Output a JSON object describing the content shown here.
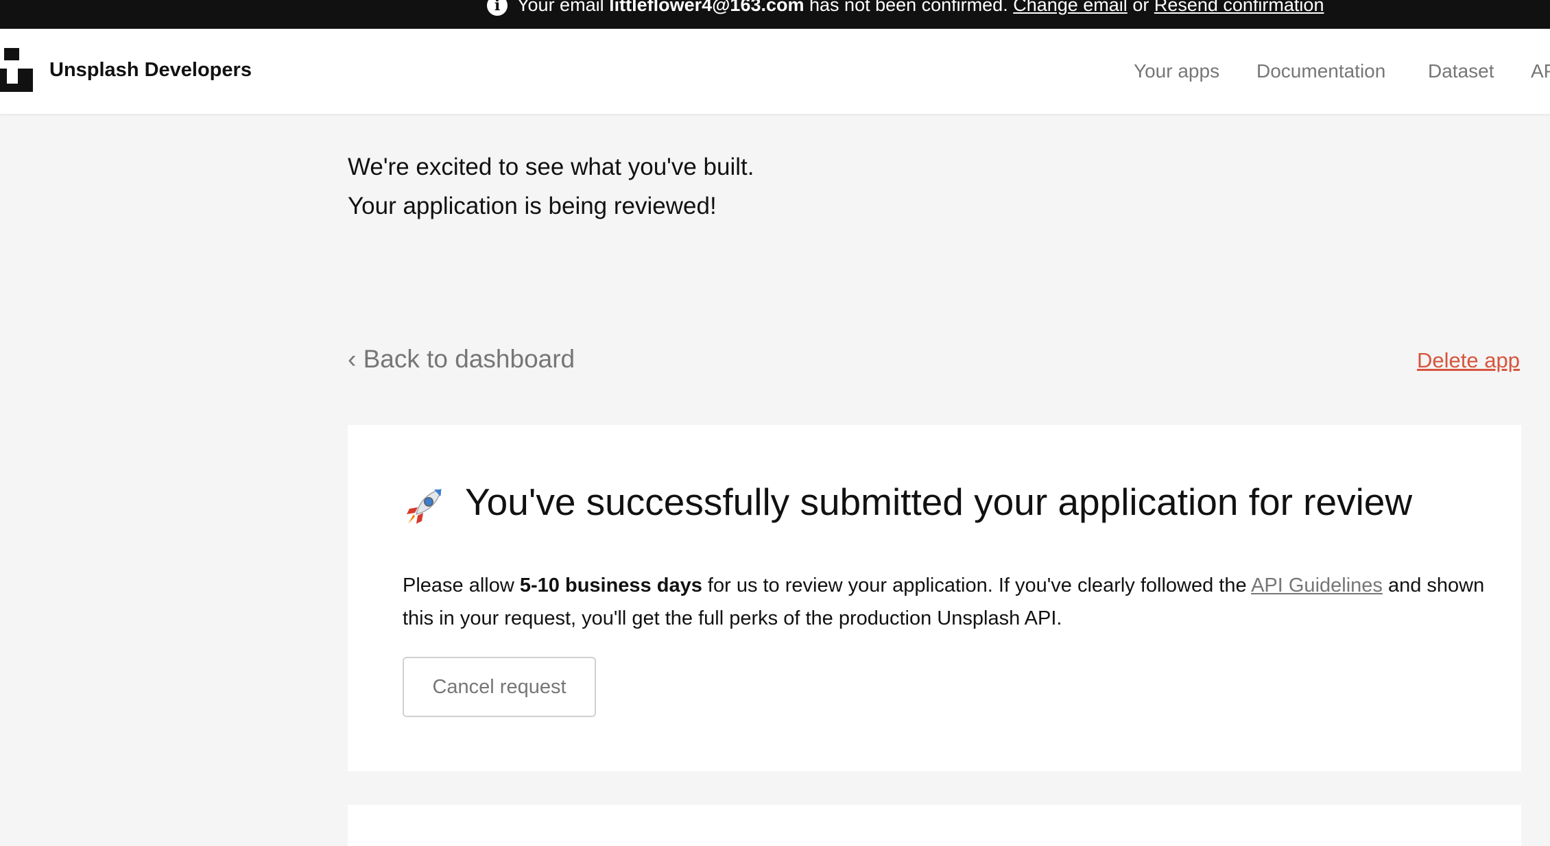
{
  "banner": {
    "prefix": "Your email ",
    "email": "littleflower4@163.com",
    "middle": " has not been confirmed. ",
    "change_email": "Change email",
    "or": " or ",
    "resend": "Resend confirmation",
    "icon": "info-icon"
  },
  "header": {
    "brand": "Unsplash Developers",
    "nav": [
      "Your apps",
      "Documentation",
      "Dataset",
      "API"
    ]
  },
  "intro": {
    "line1": "We're excited to see what you've built.",
    "line2": "Your application is being reviewed!"
  },
  "back_link": "‹ Back to dashboard",
  "delete_link": "Delete app",
  "card": {
    "icon": "rocket-icon",
    "title": "You've successfully submitted your application for review",
    "body_pre": "Please allow ",
    "body_bold": "5-10 business days",
    "body_mid": " for us to review your application. If you've clearly followed the ",
    "body_link": "API Guidelines",
    "body_post": " and shown this in your request, you'll get the full perks of the production Unsplash API.",
    "cancel_button": "Cancel request"
  },
  "colors": {
    "banner_bg": "#111111",
    "page_bg": "#f5f5f5",
    "danger": "#d6553e",
    "muted": "#767676"
  }
}
